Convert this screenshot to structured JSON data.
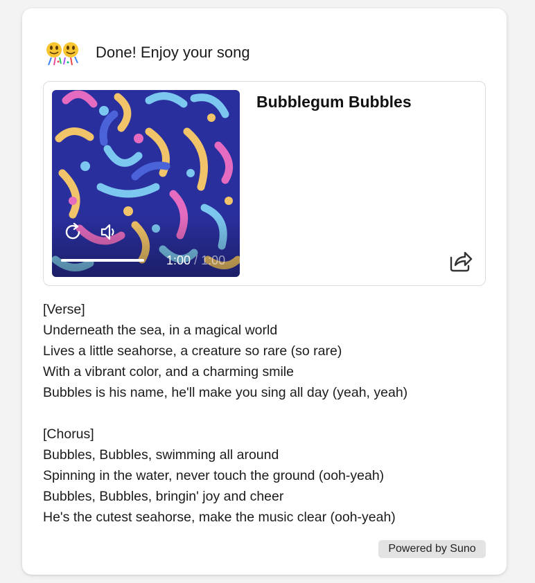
{
  "header": {
    "emoji": "🎊",
    "message": "Done! Enjoy your song"
  },
  "song": {
    "title": "Bubblegum Bubbles",
    "player": {
      "current_time": "1:00",
      "separator": "/",
      "total_time": "1:00",
      "progress_fraction": 1.0,
      "replay_icon": "replay-icon",
      "volume_icon": "volume-icon"
    },
    "share_icon": "share-icon"
  },
  "lyrics": [
    {
      "lines": [
        "[Verse]",
        "Underneath the sea, in a magical world",
        "Lives a little seahorse, a creature so rare (so rare)",
        "With a vibrant color, and a charming smile",
        "Bubbles is his name, he'll make you sing all day (yeah, yeah)"
      ]
    },
    {
      "lines": [
        "[Chorus]",
        "Bubbles, Bubbles, swimming all around",
        "Spinning in the water, never touch the ground (ooh-yeah)",
        "Bubbles, Bubbles, bringin' joy and cheer",
        "He's the cutest seahorse, make the music clear (ooh-yeah)"
      ]
    }
  ],
  "footer": {
    "powered_label": "Powered by Suno"
  },
  "colors": {
    "cover_background": "#2a2f9e",
    "pill_background": "#e3e3e3"
  }
}
